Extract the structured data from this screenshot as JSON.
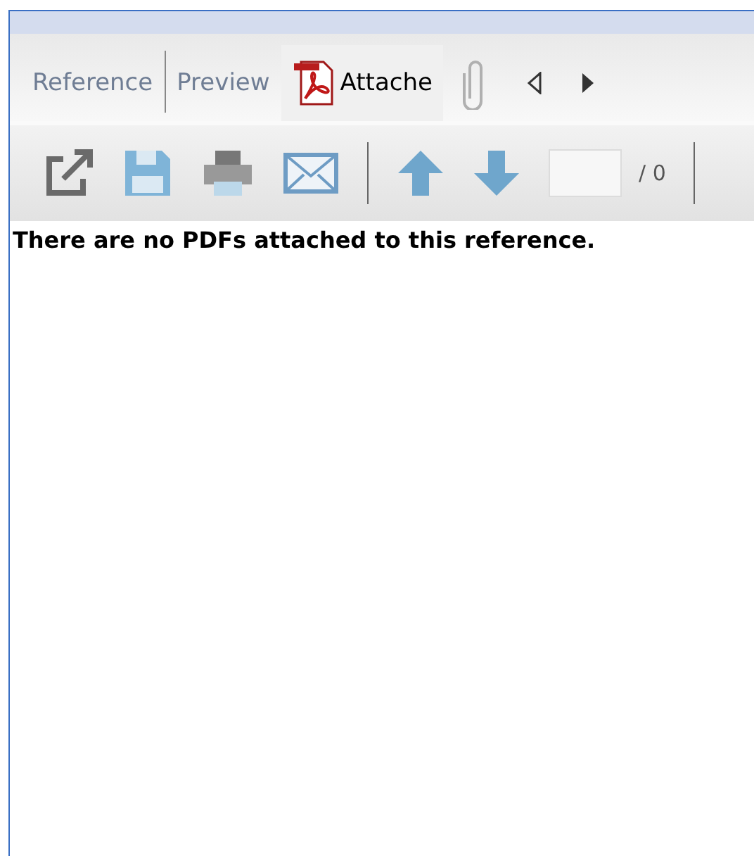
{
  "tabs": [
    {
      "label": "Reference",
      "selected": false,
      "kind": "text"
    },
    {
      "label": "Preview",
      "selected": false,
      "kind": "text"
    },
    {
      "label": "Attache",
      "selected": true,
      "kind": "pdf"
    }
  ],
  "toolbar": {
    "page_of": "/ 0"
  },
  "message": "There are no PDFs attached to this reference."
}
